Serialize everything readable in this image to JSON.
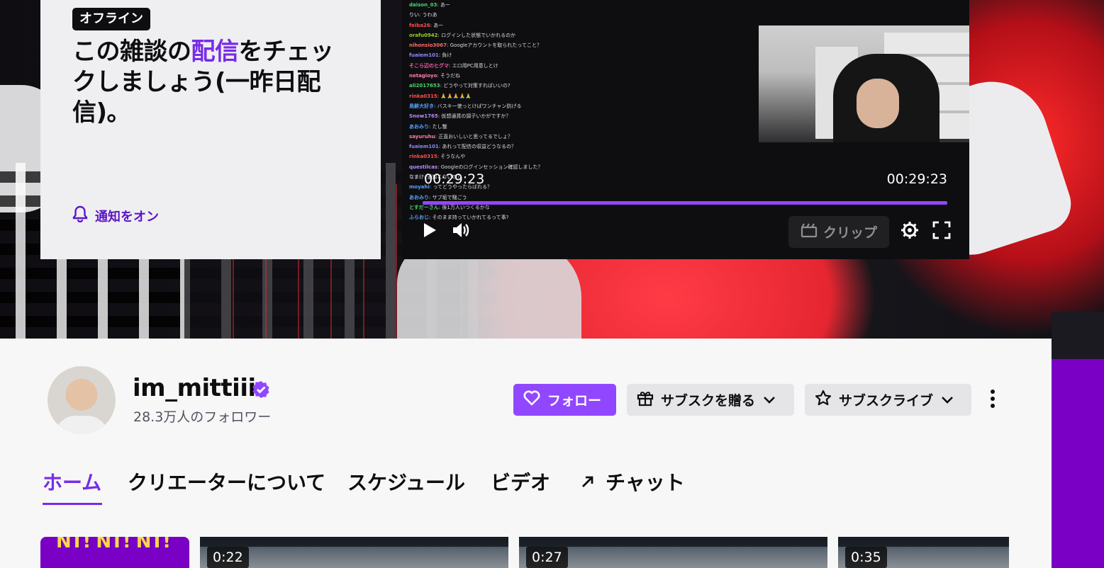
{
  "offline_card": {
    "badge": "オフライン",
    "title_before": "この雑談の",
    "title_highlight": "配信",
    "title_after": "をチェックしましょう(一昨日配信)。",
    "notify_label": "通知をオン"
  },
  "player": {
    "time_current": "00:29:23",
    "time_total": "00:29:23",
    "progress": 1.0,
    "clip_label": "クリップ",
    "chat": [
      {
        "user": "daison_03",
        "color": "#4ad66d",
        "msg": "あー"
      },
      {
        "user": "りい",
        "color": "#b0b0b8",
        "msg": "うわあ"
      },
      {
        "user": "feiba26",
        "color": "#ff4d4d",
        "msg": "あー"
      },
      {
        "user": "orafu0942",
        "color": "#9acd32",
        "msg": "ログインした状態でいかれるのか"
      },
      {
        "user": "nihonsio3067",
        "color": "#ff6a6a",
        "msg": "Googleアカウントを取られたってこと？"
      },
      {
        "user": "fuaiem101",
        "color": "#8a8aff",
        "msg": "負け"
      },
      {
        "user": "そこら辺のヒグマ",
        "color": "#ff5ab0",
        "msg": "エロ用PC用意しとけ"
      },
      {
        "user": "netagioyo",
        "color": "#ff7aa8",
        "msg": "そうだね"
      },
      {
        "user": "ali2017653",
        "color": "#4ad66d",
        "msg": "どうやって対策すればいいの?"
      },
      {
        "user": "rinka0315",
        "color": "#ff4d4d",
        "msg": "🙏🙏🙏🙏🙏"
      },
      {
        "user": "鳥鮮大好き",
        "color": "#5aa0ff",
        "msg": "バスキー使っとけばワンチャン防げる"
      },
      {
        "user": "Snow1765",
        "color": "#b98cff",
        "msg": "仮想通貨の調子いかがですか？"
      },
      {
        "user": "あおみり",
        "color": "#5aa0ff",
        "msg": "たし蟹"
      },
      {
        "user": "sayuruhu",
        "color": "#ff7aa8",
        "msg": "正直おいしいと思ってるでしょ？"
      },
      {
        "user": "fuaiem101",
        "color": "#8a8aff",
        "msg": "あれって配信の収益どうなるの？"
      },
      {
        "user": "rinka0315",
        "color": "#ff4d4d",
        "msg": "そうなんや"
      },
      {
        "user": "questilcas",
        "color": "#b98cff",
        "msg": "Googleのログインセッション確認しました？"
      },
      {
        "user": "なまけ",
        "color": "#b0b0b8",
        "msg": "通知こないの？"
      },
      {
        "user": "moyahi",
        "color": "#5aa0ff",
        "msg": "ってどうやったらばれる？"
      },
      {
        "user": "あおみり",
        "color": "#5aa0ff",
        "msg": "サブ垢で騒ごう"
      },
      {
        "user": "",
        "color": "#b0b0b8",
        "msg": ""
      },
      {
        "user": "とすだーさん",
        "color": "#4ad66d",
        "msg": "後1万人いつくるかな"
      },
      {
        "user": "ふらおじ",
        "color": "#5aa0ff",
        "msg": "そのまま持っていかれてるって事?"
      }
    ]
  },
  "channel": {
    "name": "im_mittiii",
    "followers": "28.3万人のフォロワー",
    "follow_label": "フォロー",
    "gift_label": "サブスクを贈る",
    "subscribe_label": "サブスクライブ"
  },
  "tabs": [
    {
      "label": "ホーム",
      "active": true
    },
    {
      "label": "クリエーターについて",
      "active": false
    },
    {
      "label": "スケジュール",
      "active": false
    },
    {
      "label": "ビデオ",
      "active": false
    },
    {
      "label": "チャット",
      "active": false,
      "external": true
    }
  ],
  "clips": [
    {
      "thumb_text": "NT! NT! NT!"
    },
    {
      "duration": "0:22"
    },
    {
      "duration": "0:27"
    },
    {
      "duration": "0:35"
    }
  ],
  "colors": {
    "brand": "#9147ff",
    "brand_text": "#772ce8",
    "panel_purple": "#7a00c6"
  },
  "icons": [
    "bell-icon",
    "play-icon",
    "volume-icon",
    "clip-icon",
    "gear-icon",
    "fullscreen-icon",
    "verified-icon",
    "heart-icon",
    "gift-icon",
    "chevron-down-icon",
    "star-icon",
    "more-vertical-icon",
    "external-arrow-icon"
  ]
}
